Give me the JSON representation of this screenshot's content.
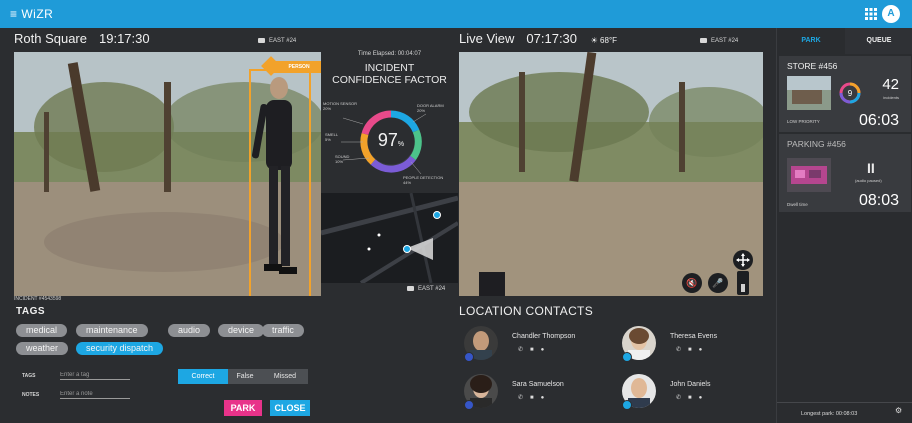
{
  "app": {
    "brand": "≡ WiZR",
    "user_initial": "A"
  },
  "left_camera": {
    "location": "Roth Square",
    "time": "19:17:30",
    "camera_name": "EAST #24",
    "detection_label": "PERSON",
    "incident_id": "INCIDENT #4543598"
  },
  "right_camera": {
    "title": "Live View",
    "time": "07:17:30",
    "temperature": "68°F",
    "camera_name": "EAST #24"
  },
  "confidence": {
    "elapsed": "Time Elapsed: 00:04:07",
    "title_line1": "INCIDENT",
    "title_line2": "CONFIDENCE FACTOR",
    "value": "97",
    "unit": "%",
    "factors": [
      {
        "label": "MOTION SENSOR",
        "value": "20%"
      },
      {
        "label": "DOOR ALARM",
        "value": "20%"
      },
      {
        "label": "SMELL",
        "value": "5%"
      },
      {
        "label": "SOUND",
        "value": "10%"
      },
      {
        "label": "PEOPLE DETECTION",
        "value": "44%"
      }
    ],
    "ring_colors": [
      "#e84a8a",
      "#f2a22a",
      "#1da7e3",
      "#7b5cd6",
      "#4cc38a"
    ],
    "minimap_camera": "EAST #24"
  },
  "tags": {
    "heading": "TAGS",
    "chips": [
      "medical",
      "maintenance",
      "audio",
      "device",
      "traffic",
      "weather",
      "security dispatch"
    ],
    "active_chip": "security dispatch"
  },
  "form": {
    "tags_label": "TAGS",
    "tags_placeholder": "Enter a tag",
    "notes_label": "NOTES",
    "notes_placeholder": "Enter a note",
    "segments": [
      "Correct",
      "False",
      "Missed"
    ],
    "active_segment": "Correct",
    "park_label": "PARK",
    "close_label": "CLOSE",
    "accent": "#1da7e3",
    "park_color": "#e8338a"
  },
  "contacts": {
    "heading": "LOCATION CONTACTS",
    "people": [
      {
        "name": "Chandler Thompson"
      },
      {
        "name": "Theresa Evens"
      },
      {
        "name": "Sara Samuelson"
      },
      {
        "name": "John Daniels"
      }
    ],
    "actions": [
      "phone-icon",
      "message-icon",
      "location-icon"
    ]
  },
  "sidebar": {
    "tabs": [
      "PARK",
      "QUEUE"
    ],
    "active_tab": "PARK",
    "store_card": {
      "title": "STORE #456",
      "count": "42",
      "count_label": "incidents",
      "ring_value": "9",
      "priority": "LOW PRIORITY",
      "timer": "06:03"
    },
    "parking_card": {
      "title": "PARKING #456",
      "status_label": "(audio paused)",
      "dwell_label": "Dwell time",
      "timer": "08:03"
    },
    "footer": "Longest park: 00:08:03"
  }
}
